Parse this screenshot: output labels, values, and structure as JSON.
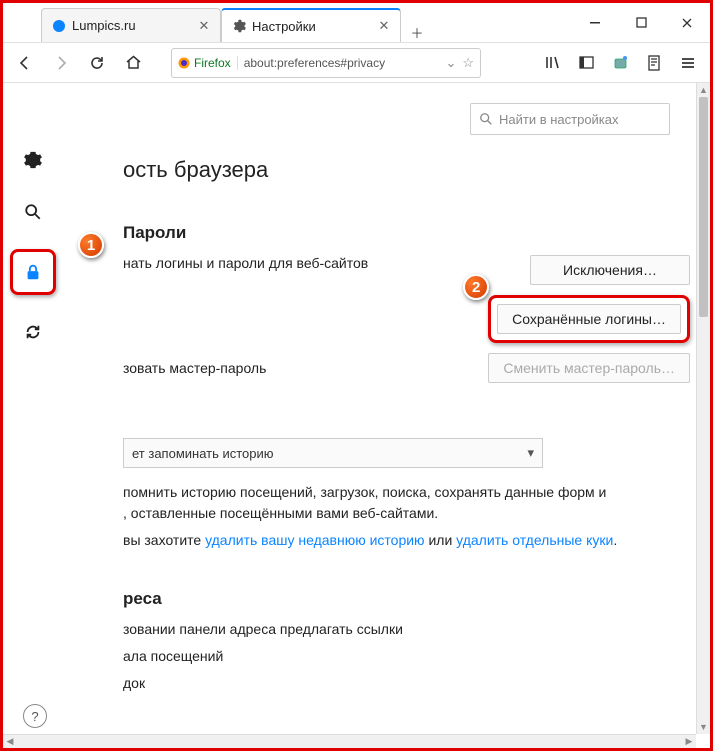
{
  "tabs": [
    {
      "title": "Lumpics.ru"
    },
    {
      "title": "Настройки"
    }
  ],
  "urlbar": {
    "identity": "Firefox",
    "url": "about:preferences#privacy"
  },
  "search": {
    "placeholder": "Найти в настройках"
  },
  "page": {
    "heading": "ость браузера",
    "passwords": {
      "title": "Пароли",
      "remember_label": "нать логины и пароли для веб-сайтов",
      "exceptions_btn": "Исключения…",
      "saved_logins_btn": "Сохранённые логины…",
      "master_label": "зовать мастер-пароль",
      "change_master_btn": "Сменить мастер-пароль…"
    },
    "history": {
      "select_value": "ет запоминать историю",
      "para1_a": "помнить историю посещений, загрузок, поиска, сохранять данные форм и",
      "para1_b": ", оставленные посещёнными вами веб-сайтами.",
      "para2_a": "вы захотите ",
      "link1": "удалить вашу недавнюю историю",
      "para2_b": " или ",
      "link2": "удалить отдельные куки",
      "para2_c": "."
    },
    "address": {
      "title": "реса",
      "line1": "зовании панели адреса предлагать ссылки",
      "line2": "ала посещений",
      "line3": "док"
    }
  },
  "markers": {
    "m1": "1",
    "m2": "2"
  }
}
